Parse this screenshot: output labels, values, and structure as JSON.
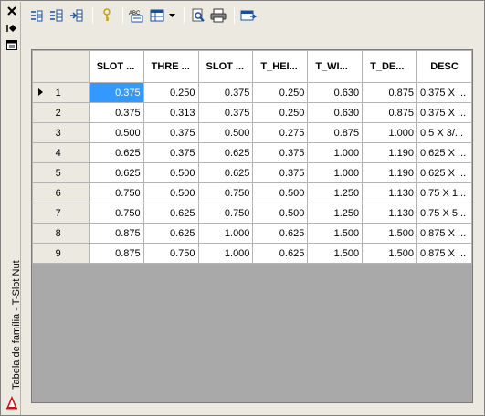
{
  "window": {
    "title_vertical": "Tabela de família - T-Slot Nut",
    "close_glyph": "✕",
    "autohide_glyph": "⧓",
    "menu_glyph": "▤"
  },
  "toolbar": {
    "icons": [
      "new-row-icon",
      "insert-row-icon",
      "export-icon",
      "key-icon",
      "spelling-icon",
      "column-setup-icon",
      "find-icon",
      "print-icon",
      "save-icon"
    ]
  },
  "table": {
    "columns": [
      "SLOT ...",
      "THRE ...",
      "SLOT ...",
      "T_HEI...",
      "T_WI...",
      "T_DE...",
      "DESC"
    ],
    "rows": [
      {
        "index": "1",
        "cells": [
          "0.375",
          "0.250",
          "0.375",
          "0.250",
          "0.630",
          "0.875",
          "0.375 X ..."
        ]
      },
      {
        "index": "2",
        "cells": [
          "0.375",
          "0.313",
          "0.375",
          "0.250",
          "0.630",
          "0.875",
          "0.375 X ..."
        ]
      },
      {
        "index": "3",
        "cells": [
          "0.500",
          "0.375",
          "0.500",
          "0.275",
          "0.875",
          "1.000",
          "0.5 X 3/..."
        ]
      },
      {
        "index": "4",
        "cells": [
          "0.625",
          "0.375",
          "0.625",
          "0.375",
          "1.000",
          "1.190",
          "0.625 X ..."
        ]
      },
      {
        "index": "5",
        "cells": [
          "0.625",
          "0.500",
          "0.625",
          "0.375",
          "1.000",
          "1.190",
          "0.625 X ..."
        ]
      },
      {
        "index": "6",
        "cells": [
          "0.750",
          "0.500",
          "0.750",
          "0.500",
          "1.250",
          "1.130",
          "0.75 X 1..."
        ]
      },
      {
        "index": "7",
        "cells": [
          "0.750",
          "0.625",
          "0.750",
          "0.500",
          "1.250",
          "1.130",
          "0.75 X 5..."
        ]
      },
      {
        "index": "8",
        "cells": [
          "0.875",
          "0.625",
          "1.000",
          "0.625",
          "1.500",
          "1.500",
          "0.875 X ..."
        ]
      },
      {
        "index": "9",
        "cells": [
          "0.875",
          "0.750",
          "1.000",
          "0.625",
          "1.500",
          "1.500",
          "0.875 X ..."
        ]
      }
    ]
  },
  "colors": {
    "selection": "#3399ff",
    "empty_area": "#a9a9a9"
  }
}
